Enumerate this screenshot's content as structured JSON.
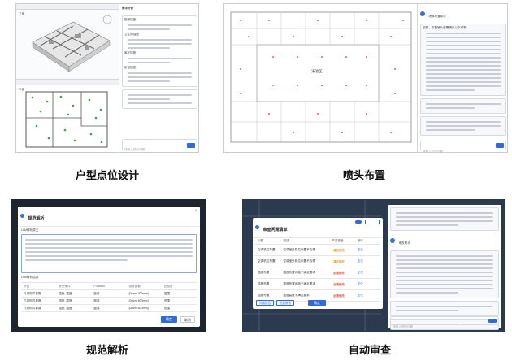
{
  "captions": {
    "p1": "户型点位设计",
    "p2": "喷头布置",
    "p3": "规范解析",
    "p4": "自动审查"
  },
  "p1": {
    "view_tabs": [
      "三维",
      "平面"
    ],
    "chat_title": "需求分析",
    "chat_bullets": [
      "厨房插座",
      "卫生间插座",
      "客厅插座",
      "卧室插座"
    ],
    "input_placeholder": "请输入您的问题"
  },
  "p2": {
    "room_label": "泳池区",
    "chat_title": "喷淋布置助手",
    "assistant_intro": "您好，布置喷头前需确认以下参数：",
    "input_placeholder": "请输入您的问题"
  },
  "p3": {
    "dialog_title": "规范解析",
    "section_1": "LLM解析原文",
    "section_2": "LLM解析结果",
    "columns": [
      "分类",
      "安全条件",
      "Function",
      "设计参数",
      "比较符"
    ],
    "rows": [
      [
        "几何构件参数",
        "插座, 插座",
        "距离",
        "[0mm, 300mm]",
        "范围"
      ],
      [
        "几何构件参数",
        "插座, 插座",
        "距离",
        "[0mm, 600mm]",
        "范围"
      ],
      [
        "几何构件参数",
        "插座, 插座",
        "距离",
        "[0mm, 600mm]",
        "范围"
      ]
    ],
    "confirm_label": "确定",
    "cancel_label": "取消"
  },
  "p4": {
    "dialog_title": "审查问题清单",
    "columns": [
      "问题",
      "描述",
      "严重程度",
      "操作"
    ],
    "rows": [
      [
        "空调机位布置",
        "空调室外机位布置不合理",
        "建议修改",
        "定位"
      ],
      [
        "空调机位布置",
        "空调室外机位布置不合理",
        "建议修改",
        "定位"
      ],
      [
        "插座布置",
        "插座布置间距不满足要求",
        "必须修改",
        "定位"
      ],
      [
        "插座布置",
        "插座布置间距不满足要求",
        "必须修改",
        "定位"
      ],
      [
        "插座布置",
        "插座高度不满足要求",
        "必须修改",
        "定位"
      ]
    ],
    "footer_buttons": [
      "问题报告",
      "批量修改"
    ],
    "confirm_label": "确定",
    "chat_title": "审查助手",
    "input_placeholder": "请输入您的问题"
  },
  "colors": {
    "accent": "#2f6bdb",
    "danger": "#e0523e",
    "warning": "#e89a2c",
    "dark_bg": "#2b3a4e"
  }
}
